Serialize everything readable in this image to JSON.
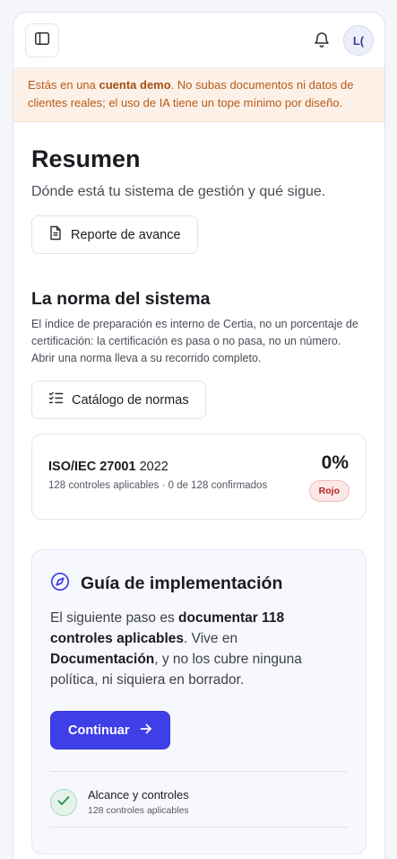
{
  "header": {
    "avatar_initials": "L("
  },
  "demo_banner": {
    "prefix": "Estás en una ",
    "bold": "cuenta demo",
    "suffix": ". No subas documentos ni datos de clientes reales; el uso de IA tiene un tope mínimo por diseño."
  },
  "summary": {
    "title": "Resumen",
    "subtitle": "Dónde está tu sistema de gestión y qué sigue.",
    "report_button": "Reporte de avance"
  },
  "standard": {
    "title": "La norma del sistema",
    "description": "El índice de preparación es interno de Certia, no un porcentaje de certificación: la certificación es pasa o no pasa, no un número. Abrir una norma lleva a su recorrido completo.",
    "catalog_button": "Catálogo de normas",
    "card": {
      "name": "ISO/IEC 27001",
      "year": "2022",
      "meta": "128 controles aplicables · 0 de 128 confirmados",
      "percent": "0%",
      "status": "Rojo"
    }
  },
  "guide": {
    "title": "Guía de implementación",
    "body_1": "El siguiente paso es ",
    "body_bold_1": "documentar 118 controles aplicables",
    "body_2": ". Vive en ",
    "body_bold_2": "Documentación",
    "body_3": ", y no los cubre ninguna política, ni siquiera en borrador.",
    "continue_button": "Continuar",
    "steps": [
      {
        "title": "Alcance y controles",
        "subtitle": "128 controles aplicables"
      }
    ]
  },
  "colors": {
    "primary": "#3f3fe8",
    "banner_bg": "#fdf1e7",
    "banner_text": "#b65a1a",
    "status_red": "#b42323",
    "success": "#2e8a4f"
  },
  "icons": {
    "sidebar_toggle": "sidebar-toggle-icon",
    "bell": "bell-icon",
    "report": "document-icon",
    "catalog": "checklist-icon",
    "guide": "compass-icon",
    "continue": "arrow-right-icon",
    "step_done": "check-icon"
  }
}
